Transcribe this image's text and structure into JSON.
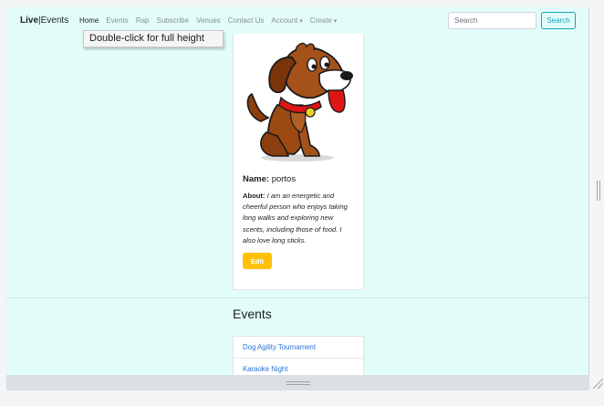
{
  "navbar": {
    "brand_bold": "Live",
    "brand_sep": "|",
    "brand_rest": "Events",
    "links": [
      "Home",
      "Events",
      "Rap",
      "Subscribe",
      "Venues",
      "Contact Us"
    ],
    "account_label": "Account",
    "create_label": "Create",
    "search_placeholder": "Search",
    "search_button": "Search"
  },
  "tooltip": "Double-click for full height",
  "profile": {
    "name_label": "Name:",
    "name_value": "portos",
    "about_label": "About:",
    "about_text": "I am an energetic and cheerful person who enjoys taking long walks and exploring new scents, including those of food. I also love long sticks.",
    "edit_label": "Edit"
  },
  "events": {
    "heading": "Events",
    "items": [
      "Dog Agility Tournament",
      "Karaoke Night"
    ]
  },
  "colors": {
    "page_bg": "#e2fdf9",
    "edit_button": "#ffc107",
    "link": "#2c74d6",
    "search_accent": "#17a2b8"
  }
}
